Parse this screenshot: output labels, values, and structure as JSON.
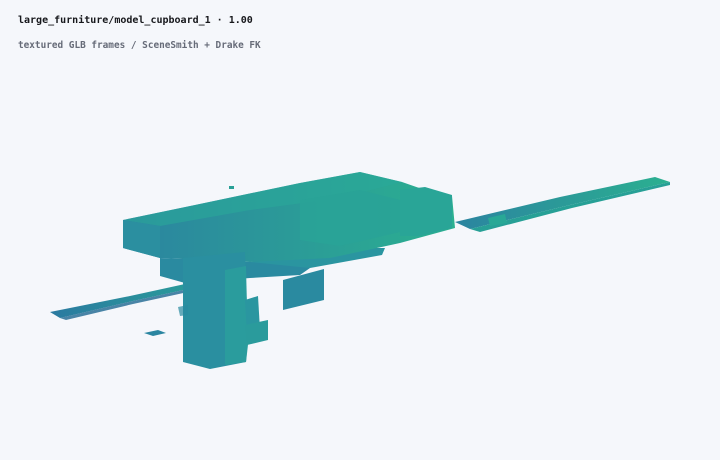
{
  "header": {
    "title": "large_furniture/model_cupboard_1 · 1.00",
    "subtitle": "textured GLB frames / SceneSmith + Drake FK"
  },
  "scene": {
    "background_color": "#f5f7fb",
    "palette": {
      "dark": "#2d7d9a",
      "mid": "#2b969c",
      "mid_dark": "#2a8a9c",
      "light": "#27a695",
      "lightest": "#28b092"
    }
  }
}
